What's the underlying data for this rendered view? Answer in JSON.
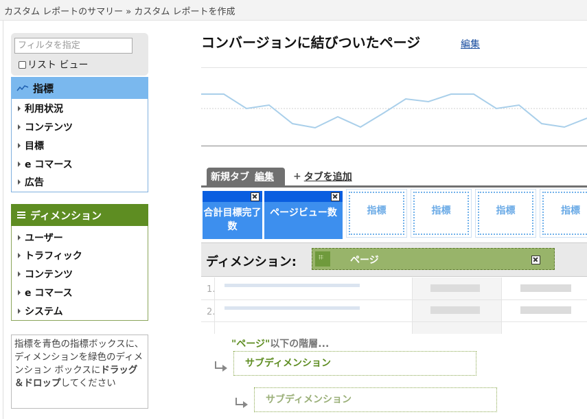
{
  "breadcrumb": "カスタム レポートのサマリー » カスタム レポートを作成",
  "sidebar": {
    "filter_placeholder": "フィルタを指定",
    "list_view_label": "リスト ビュー",
    "metrics": {
      "title": "指標",
      "items": [
        "利用状況",
        "コンテンツ",
        "目標",
        "e コマース",
        "広告"
      ]
    },
    "dimensions": {
      "title": "ディメンション",
      "items": [
        "ユーザー",
        "トラフィック",
        "コンテンツ",
        "e コマース",
        "システム"
      ]
    },
    "help": {
      "part1": "指標を青色の指標ボックスに、ディメンションを緑色のディメンション ボックスに",
      "bold": "ドラッグ＆ドロップ",
      "part2": "してください"
    }
  },
  "report": {
    "title": "コンバージョンに結びついたページ",
    "edit_label": "編集"
  },
  "tabs": {
    "active_label": "新規タブ",
    "edit_label": "編集",
    "add_label": "タブを追加"
  },
  "metrics_row": {
    "filled": [
      "合計目標完了数",
      "ページビュー数"
    ],
    "empty_slot_label": "指標"
  },
  "dimension_row": {
    "label": "ディメンション:",
    "value": "ページ"
  },
  "table": {
    "row_numbers": [
      "1.",
      "2."
    ]
  },
  "hierarchy": {
    "quoted": "\"ページ\"",
    "suffix": "以下の階層...",
    "subdim1": "サブディメンション",
    "subdim2": "サブディメンション"
  },
  "colors": {
    "metric_blue": "#3d8fee",
    "metric_header": "#7ab8ee",
    "dimension_green": "#5e8d22",
    "dimension_chip": "#98b46a",
    "link_blue": "#1a4ea0"
  }
}
